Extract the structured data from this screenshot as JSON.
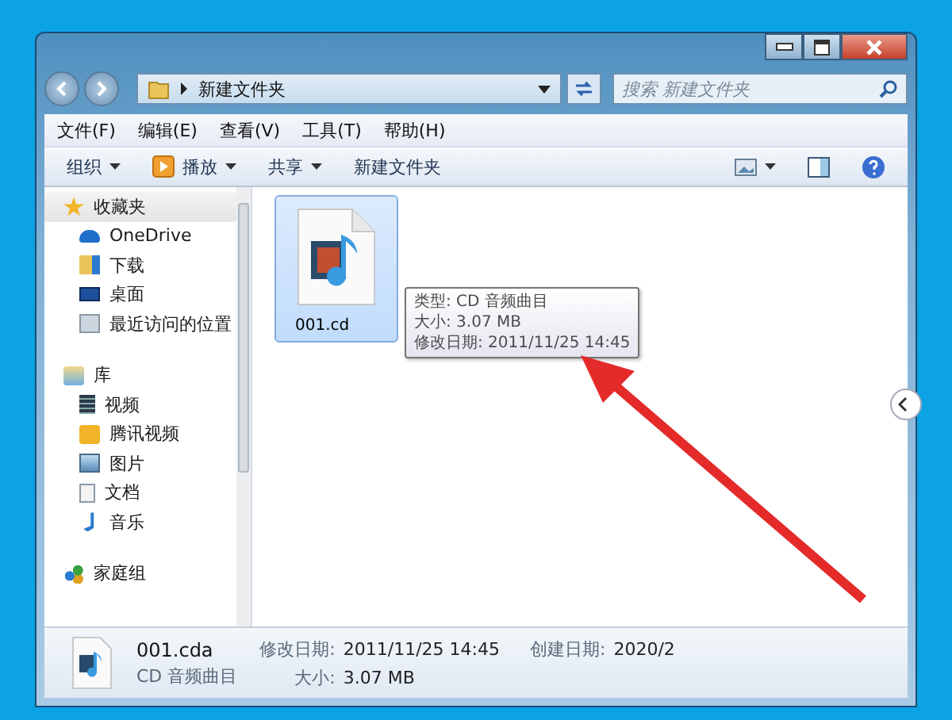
{
  "address": {
    "path": "新建文件夹"
  },
  "search": {
    "placeholder": "搜索 新建文件夹"
  },
  "menu": [
    "文件(F)",
    "编辑(E)",
    "查看(V)",
    "工具(T)",
    "帮助(H)"
  ],
  "toolbar": [
    {
      "label": "组织",
      "kind": "dropdown"
    },
    {
      "label": "播放",
      "kind": "play"
    },
    {
      "label": "共享",
      "kind": "dropdown"
    },
    {
      "label": "新建文件夹",
      "kind": "plain"
    }
  ],
  "sidebar": {
    "groups": [
      {
        "label": "收藏夹",
        "kind": "star",
        "selected": true,
        "children": [
          {
            "label": "OneDrive",
            "kind": "cloud",
            "selected": false
          },
          {
            "label": "下载",
            "kind": "download",
            "selected": false
          },
          {
            "label": "桌面",
            "kind": "desktop",
            "selected": false
          },
          {
            "label": "最近访问的位置",
            "kind": "recent",
            "selected": false
          }
        ]
      },
      {
        "label": "库",
        "kind": "library",
        "selected": false,
        "children": [
          {
            "label": "视频",
            "kind": "video",
            "selected": false
          },
          {
            "label": "腾讯视频",
            "kind": "tencent",
            "selected": false
          },
          {
            "label": "图片",
            "kind": "picture",
            "selected": false
          },
          {
            "label": "文档",
            "kind": "document",
            "selected": false
          },
          {
            "label": "音乐",
            "kind": "music",
            "selected": false
          }
        ]
      },
      {
        "label": "家庭组",
        "kind": "homegroup",
        "selected": false
      }
    ]
  },
  "files": [
    {
      "name": "001.cd",
      "selected": true
    }
  ],
  "tooltip": {
    "lines": [
      "类型: CD 音频曲目",
      "大小: 3.07 MB",
      "修改日期: 2011/11/25 14:45"
    ]
  },
  "details": {
    "name": "001.cda",
    "type": "CD 音频曲目",
    "fields": [
      {
        "label": "修改日期:",
        "value": "2011/11/25 14:45"
      },
      {
        "label": "创建日期:",
        "value": "2020/2"
      },
      {
        "label": "大小:",
        "value": "3.07 MB"
      }
    ]
  }
}
